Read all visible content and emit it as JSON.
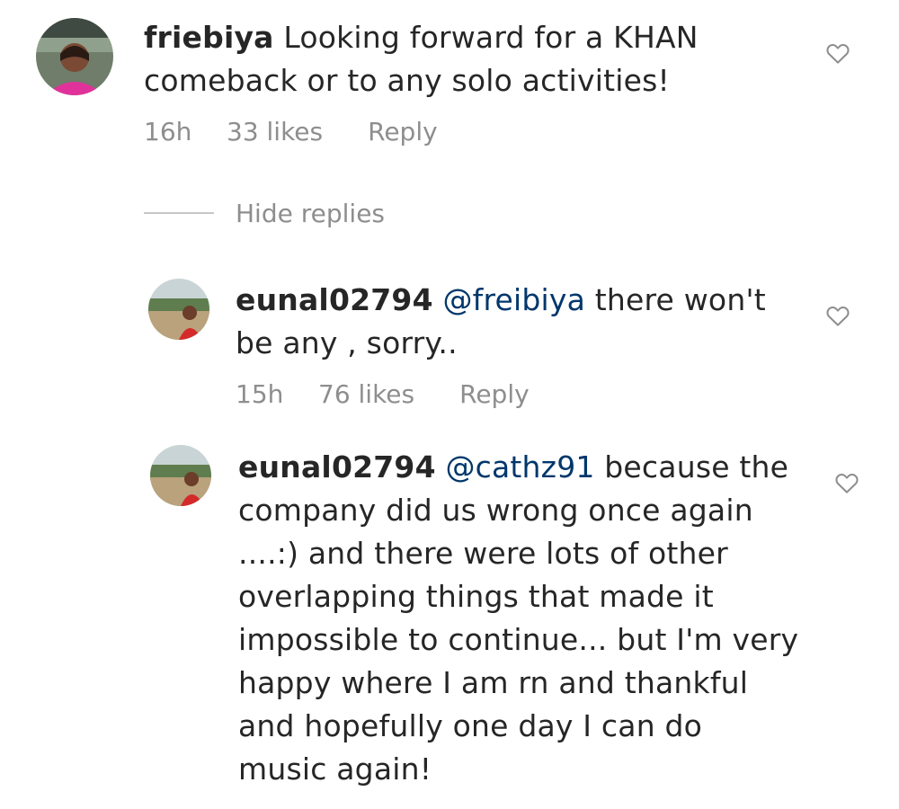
{
  "comments": [
    {
      "username": "friebiya",
      "mention": "",
      "text": " Looking forward for a KHAN comeback or to any solo activities!",
      "time": "16h",
      "likes": "33 likes",
      "reply": "Reply"
    },
    {
      "username": "eunal02794",
      "mention": " @freibiya",
      "text": " there won't be any , sorry..",
      "time": "15h",
      "likes": "76 likes",
      "reply": "Reply"
    },
    {
      "username": "eunal02794",
      "mention": " @cathz91",
      "text": " because the company did us wrong once again ....:) and there were lots of other overlapping things that made it impossible to continue... but I'm very happy where I am rn and thankful and hopefully one day I can do music again!",
      "time": "",
      "likes": "",
      "reply": ""
    }
  ],
  "thread": {
    "hide_replies_label": "Hide replies"
  },
  "icons": {
    "heart": "heart-outline-icon"
  },
  "colors": {
    "text": "#262626",
    "meta": "#8e8e8e",
    "mention": "#00376b"
  }
}
